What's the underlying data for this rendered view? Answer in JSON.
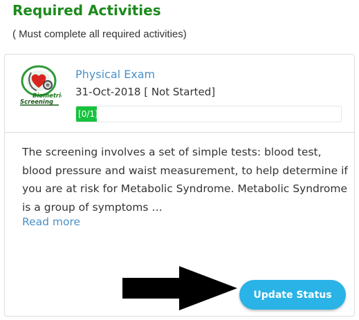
{
  "section": {
    "title": "Required Activities",
    "subtitle": "( Must complete all required activities)"
  },
  "activity": {
    "logo_text_top": "Biometric",
    "logo_text_bottom": "Screening",
    "logo_icon": "heart-stethoscope-icon",
    "name": "Physical Exam",
    "date_status": "31-Oct-2018 [ Not Started]",
    "progress_label": "[0/1]",
    "progress_completed": 0,
    "progress_total": 1,
    "description": "The screening involves a set of simple tests: blood test, blood pressure and waist measurement, to help determine if you are at risk for Metabolic Syndrome. Metabolic Syndrome is a group of symptoms …",
    "read_more": "Read more",
    "button_label": "Update Status"
  },
  "colors": {
    "title": "#1c8a1c",
    "link": "#4a90c8",
    "progress": "#16c23d",
    "button": "#2ab3e6",
    "arrow": "#000000"
  }
}
